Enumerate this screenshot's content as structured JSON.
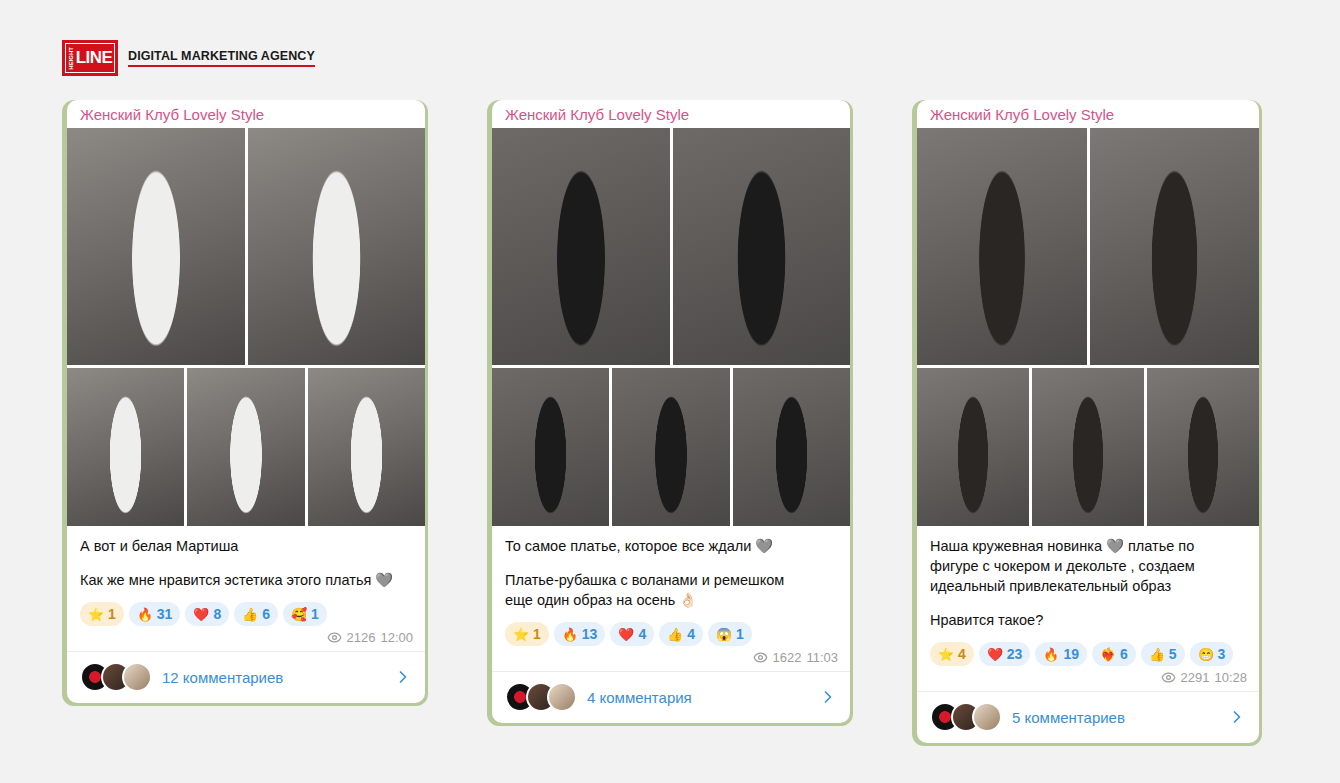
{
  "brand": {
    "mark_top": "HEIGHT",
    "mark": "LINE",
    "name": "DIGITAL MARKETING AGENCY"
  },
  "posts": [
    {
      "channel": "Женский Клуб Lovely Style",
      "paragraphs": [
        [
          "А вот и белая Мартиша"
        ],
        [
          "Как же мне нравится эстетика этого платья 🩶"
        ]
      ],
      "reactions": [
        {
          "emoji": "⭐",
          "count": "1",
          "kind": "paid"
        },
        {
          "emoji": "🔥",
          "count": "31",
          "kind": "regular"
        },
        {
          "emoji": "❤️",
          "count": "8",
          "kind": "regular"
        },
        {
          "emoji": "👍",
          "count": "6",
          "kind": "regular"
        },
        {
          "emoji": "🥰",
          "count": "1",
          "kind": "regular"
        }
      ],
      "views": "2126",
      "time": "12:00",
      "comments": "12 комментариев"
    },
    {
      "channel": "Женский Клуб Lovely Style",
      "paragraphs": [
        [
          "То самое платье, которое все ждали 🩶"
        ],
        [
          "Платье-рубашка с воланами и ремешком",
          "еще один образ на осень 👌🏻"
        ]
      ],
      "reactions": [
        {
          "emoji": "⭐",
          "count": "1",
          "kind": "paid"
        },
        {
          "emoji": "🔥",
          "count": "13",
          "kind": "regular"
        },
        {
          "emoji": "❤️",
          "count": "4",
          "kind": "regular"
        },
        {
          "emoji": "👍",
          "count": "4",
          "kind": "regular"
        },
        {
          "emoji": "😱",
          "count": "1",
          "kind": "regular"
        }
      ],
      "views": "1622",
      "time": "11:03",
      "comments": "4 комментария"
    },
    {
      "channel": "Женский Клуб Lovely Style",
      "paragraphs": [
        [
          "Наша кружевная новинка 🩶 платье по фигуре с чокером и декольте , создаем идеальный привлекательный образ"
        ],
        [
          "Нравится такое?"
        ]
      ],
      "reactions": [
        {
          "emoji": "⭐",
          "count": "4",
          "kind": "paid"
        },
        {
          "emoji": "❤️",
          "count": "23",
          "kind": "regular"
        },
        {
          "emoji": "🔥",
          "count": "19",
          "kind": "regular"
        },
        {
          "emoji": "❤️‍🔥",
          "count": "6",
          "kind": "regular"
        },
        {
          "emoji": "👍",
          "count": "5",
          "kind": "regular"
        },
        {
          "emoji": "😁",
          "count": "3",
          "kind": "regular"
        }
      ],
      "views": "2291",
      "time": "10:28",
      "comments": "5 комментариев"
    }
  ]
}
